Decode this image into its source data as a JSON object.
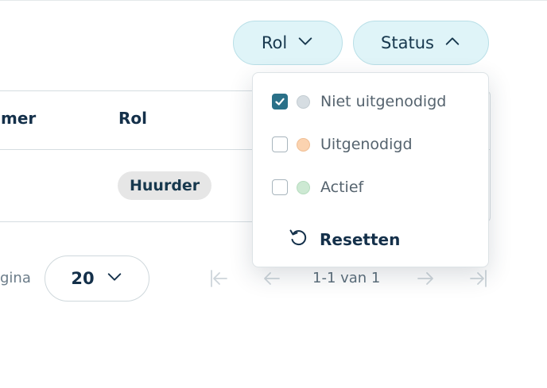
{
  "filters": {
    "rol_label": "Rol",
    "status_label": "Status"
  },
  "table": {
    "headers": [
      "mer",
      "Rol"
    ],
    "rows": [
      {
        "rol": "Huurder"
      }
    ]
  },
  "pagination": {
    "per_page_label": "gina",
    "page_size": "20",
    "range": "1-1 van 1"
  },
  "status_menu": {
    "options": [
      {
        "label": "Niet uitgenodigd",
        "checked": true,
        "dot_color": "#d6dde2"
      },
      {
        "label": "Uitgenodigd",
        "checked": false,
        "dot_color": "#fbd3b0"
      },
      {
        "label": "Actief",
        "checked": false,
        "dot_color": "#cde9d3"
      }
    ],
    "reset_label": "Resetten"
  },
  "colors": {
    "pill_bg": "#dff4f8",
    "accent": "#2a7088",
    "text_dark": "#14304a"
  },
  "icons": {
    "chevron_down": "chevron-down-icon",
    "chevron_up": "chevron-up-icon",
    "check": "check-icon",
    "reset": "reset-icon",
    "first_page": "first-page-icon",
    "prev_page": "arrow-left-icon",
    "next_page": "arrow-right-icon",
    "last_page": "last-page-icon"
  }
}
